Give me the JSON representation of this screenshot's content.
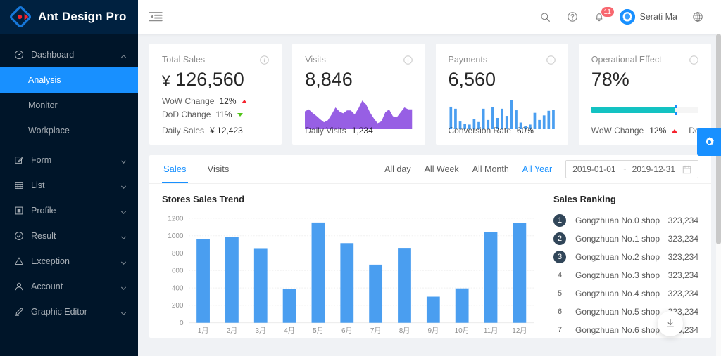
{
  "app": {
    "logo_icon": "ant-design-logo-icon",
    "title": "Ant Design Pro",
    "accent_color": "#1890ff",
    "sidebar_bg": "#001529",
    "logo_bg": "#002140"
  },
  "sidebar": {
    "dashboard": {
      "icon": "dashboard-icon",
      "label": "Dashboard",
      "arrow_icon": "chevron-up-icon",
      "children": [
        {
          "label": "Analysis",
          "active": true
        },
        {
          "label": "Monitor",
          "active": false
        },
        {
          "label": "Workplace",
          "active": false
        }
      ]
    },
    "items": [
      {
        "icon": "form-icon",
        "label": "Form",
        "arrow_icon": "chevron-down-icon"
      },
      {
        "icon": "table-icon",
        "label": "List",
        "arrow_icon": "chevron-down-icon"
      },
      {
        "icon": "profile-icon",
        "label": "Profile",
        "arrow_icon": "chevron-down-icon"
      },
      {
        "icon": "check-circle-icon",
        "label": "Result",
        "arrow_icon": "chevron-down-icon"
      },
      {
        "icon": "warning-icon",
        "label": "Exception",
        "arrow_icon": "chevron-down-icon"
      },
      {
        "icon": "user-icon",
        "label": "Account",
        "arrow_icon": "chevron-down-icon"
      },
      {
        "icon": "highlight-icon",
        "label": "Graphic Editor",
        "arrow_icon": "chevron-down-icon"
      }
    ]
  },
  "header": {
    "fold_icon": "menu-fold-icon",
    "search_icon": "search-icon",
    "help_icon": "question-circle-icon",
    "bell_icon": "bell-icon",
    "notification_count": "11",
    "notification_badge_color": "#f5222d",
    "avatar_icon": "avatar-icon",
    "user_name": "Serati Ma",
    "global_icon": "global-icon"
  },
  "cards": [
    {
      "title": "Total Sales",
      "info_icon": "info-circle-icon",
      "currency": "¥",
      "value": "126,560",
      "type": "trends",
      "trends": [
        {
          "label": "WoW Change",
          "value": "12%",
          "dir": "up"
        },
        {
          "label": "DoD Change",
          "value": "11%",
          "dir": "down"
        }
      ],
      "footer_label": "Daily Sales",
      "footer_value": "¥ 12,423"
    },
    {
      "title": "Visits",
      "info_icon": "info-circle-icon",
      "value": "8,846",
      "type": "area",
      "chart_color": "#975fe4",
      "footer_label": "Daily Visits",
      "footer_value": "1,234"
    },
    {
      "title": "Payments",
      "info_icon": "info-circle-icon",
      "value": "6,560",
      "type": "bars",
      "chart_color": "#4a9ef0",
      "footer_label": "Conversion Rate",
      "footer_value": "60%"
    },
    {
      "title": "Operational Effect",
      "info_icon": "info-circle-icon",
      "value": "78%",
      "type": "progress",
      "progress_percent": 78,
      "progress_color": "#13c2c2",
      "progress_mark_color": "#1890ff",
      "trends_inline": [
        {
          "label": "WoW Change",
          "value": "12%",
          "dir": "up"
        },
        {
          "label": "DoD Ch",
          "value": "",
          "dir": ""
        }
      ]
    }
  ],
  "panel": {
    "tabs": [
      {
        "label": "Sales",
        "active": true
      },
      {
        "label": "Visits",
        "active": false
      }
    ],
    "ranges": [
      {
        "label": "All day",
        "active": false
      },
      {
        "label": "All Week",
        "active": false
      },
      {
        "label": "All Month",
        "active": false
      },
      {
        "label": "All Year",
        "active": true
      }
    ],
    "date_start": "2019-01-01",
    "date_sep": "~",
    "date_end": "2019-12-31",
    "calendar_icon": "calendar-icon",
    "chart_title": "Stores Sales Trend",
    "ranking_title": "Sales Ranking",
    "ranking": [
      {
        "no": "1",
        "name": "Gongzhuan No.0 shop",
        "value": "323,234"
      },
      {
        "no": "2",
        "name": "Gongzhuan No.1 shop",
        "value": "323,234"
      },
      {
        "no": "3",
        "name": "Gongzhuan No.2 shop",
        "value": "323,234"
      },
      {
        "no": "4",
        "name": "Gongzhuan No.3 shop",
        "value": "323,234"
      },
      {
        "no": "5",
        "name": "Gongzhuan No.4 shop",
        "value": "323,234"
      },
      {
        "no": "6",
        "name": "Gongzhuan No.5 shop",
        "value": "323,234"
      },
      {
        "no": "7",
        "name": "Gongzhuan No.6 shop",
        "value": "323,234"
      }
    ]
  },
  "floating": {
    "settings_icon": "gear-icon",
    "settings_color": "#1890ff",
    "download_icon": "download-icon"
  },
  "chart_data": [
    {
      "type": "bar",
      "title": "Stores Sales Trend",
      "categories": [
        "1月",
        "2月",
        "3月",
        "4月",
        "5月",
        "6月",
        "7月",
        "8月",
        "9月",
        "10月",
        "11月",
        "12月"
      ],
      "values": [
        965,
        982,
        857,
        390,
        1152,
        915,
        668,
        860,
        300,
        395,
        1040,
        1150
      ],
      "xlabel": "",
      "ylabel": "",
      "ylim": [
        0,
        1200
      ],
      "yticks": [
        0,
        200,
        400,
        600,
        800,
        1000,
        1200
      ],
      "grid": true,
      "legend": false,
      "color": "#4a9ef0"
    },
    {
      "type": "area",
      "title": "Visits",
      "values": [
        36,
        40,
        33,
        27,
        20,
        14,
        18,
        30,
        44,
        36,
        32,
        38,
        38,
        30,
        42,
        58,
        50,
        34,
        22,
        12,
        16,
        34,
        40,
        26,
        24,
        34,
        44,
        40,
        40
      ],
      "ylim": [
        0,
        60
      ],
      "color": "#975fe4",
      "legend": false,
      "grid": false
    },
    {
      "type": "bar",
      "title": "Payments",
      "values": [
        44,
        40,
        15,
        11,
        9,
        20,
        14,
        40,
        18,
        43,
        22,
        40,
        26,
        57,
        37,
        13,
        6,
        9,
        32,
        18,
        27,
        36,
        38
      ],
      "ylim": [
        0,
        60
      ],
      "color": "#4a9ef0",
      "legend": false,
      "grid": false
    }
  ]
}
